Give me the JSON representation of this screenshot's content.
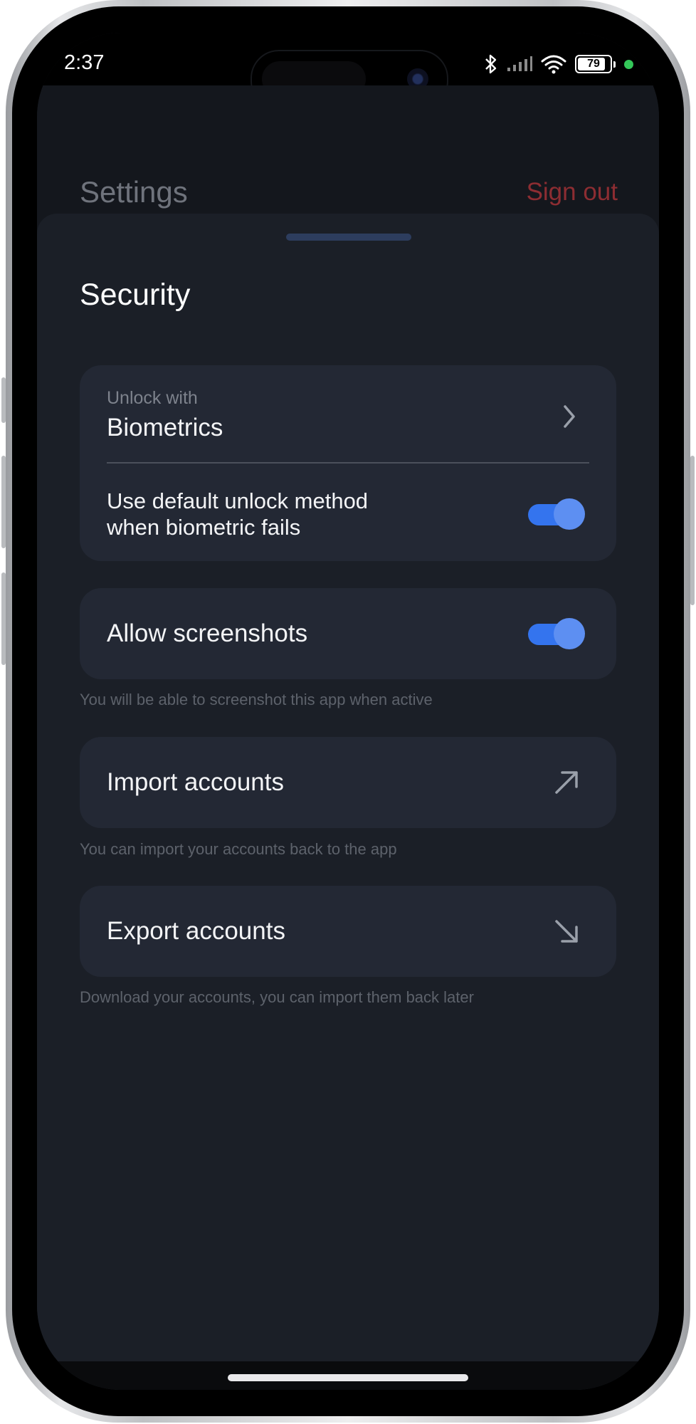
{
  "status_bar": {
    "time": "2:37",
    "battery": "79",
    "icons": [
      "bluetooth-icon",
      "cellular-signal-icon",
      "wifi-icon",
      "battery-icon",
      "privacy-indicator-dot"
    ]
  },
  "header": {
    "title": "Settings",
    "sign_out_label": "Sign out"
  },
  "sheet": {
    "title": "Security",
    "unlock": {
      "label": "Unlock with",
      "value": "Biometrics",
      "icon": "chevron-right-icon"
    },
    "default_unlock": {
      "label_line1": "Use default unlock method",
      "label_line2": "when biometric fails",
      "enabled": true
    },
    "screenshots": {
      "label": "Allow screenshots",
      "enabled": true,
      "helper": "You will be able to screenshot this app when active"
    },
    "import": {
      "label": "Import accounts",
      "icon": "arrow-up-right-icon",
      "helper": "You can import your accounts back to the app"
    },
    "export": {
      "label": "Export accounts",
      "icon": "arrow-down-right-icon",
      "helper": "Download your accounts, you can import them back later"
    }
  },
  "colors": {
    "accent": "#3474ee",
    "danger": "#8d2d32",
    "card": "#232834",
    "sheet": "#1b1f27"
  }
}
